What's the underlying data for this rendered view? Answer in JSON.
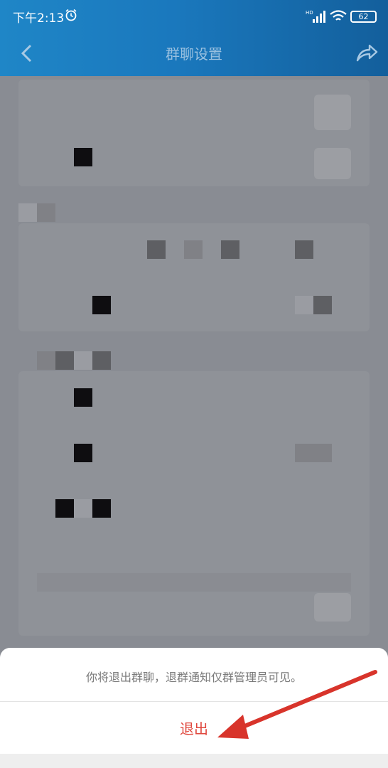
{
  "status_bar": {
    "time": "下午2:13",
    "network": "HD",
    "battery": "62"
  },
  "header": {
    "title": "群聊设置"
  },
  "sheet": {
    "message": "你将退出群聊，退群通知仅群管理员可见。",
    "exit_label": "退出"
  },
  "colors": {
    "header": "#1a78bd",
    "exit_text": "#e0483e",
    "arrow": "#d8342b",
    "overlay": "#898c93"
  }
}
